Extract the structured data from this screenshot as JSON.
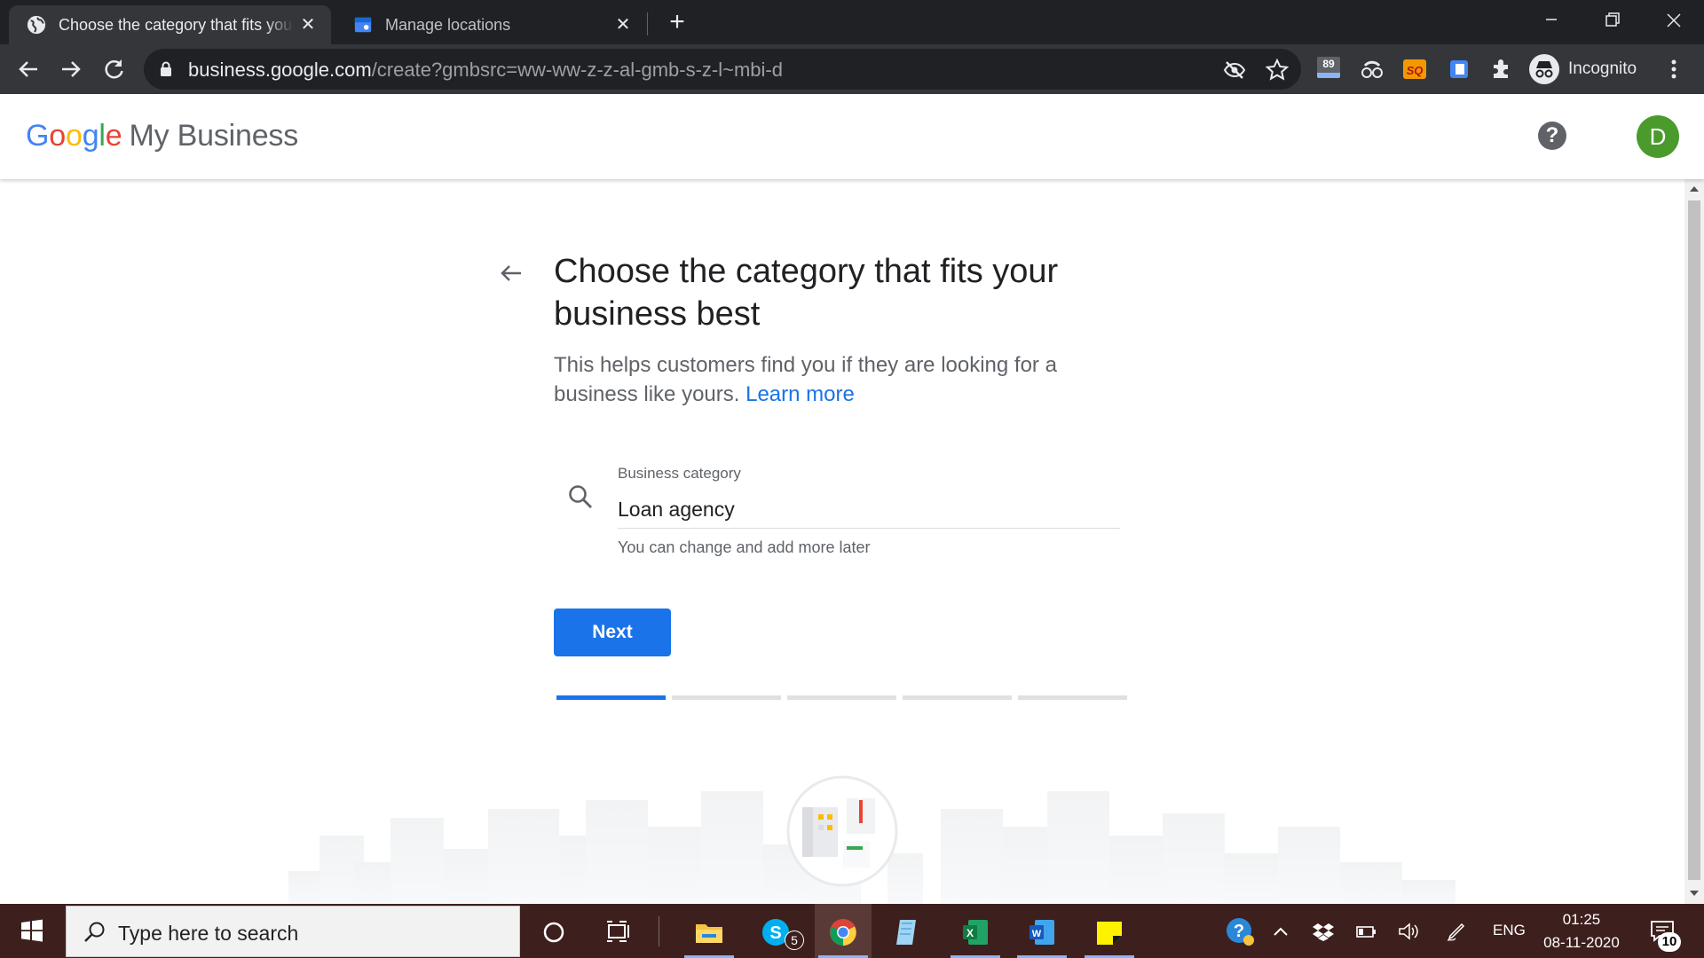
{
  "browser": {
    "tabs": [
      {
        "title": "Choose the category that fits your business best",
        "active": true
      },
      {
        "title": "Manage locations",
        "active": false
      }
    ],
    "url_host": "business.google.com",
    "url_path": "/create?gmbsrc=ww-ww-z-z-al-gmb-s-z-l~mbi-d",
    "extension_badge": "89",
    "profile_label": "Incognito"
  },
  "header": {
    "logo_letters": [
      "G",
      "o",
      "o",
      "g",
      "l",
      "e"
    ],
    "product_name": "My Business",
    "help_glyph": "?",
    "avatar_initial": "D",
    "avatar_color": "#4a9a2c"
  },
  "main": {
    "title": "Choose the category that fits your business best",
    "description": "This helps customers find you if they are looking for a business like yours.",
    "learn_more": "Learn more",
    "field_label": "Business category",
    "field_value": "Loan agency",
    "field_hint": "You can change and add more later",
    "next_label": "Next",
    "progress": {
      "current_step": 1,
      "total_steps": 5
    },
    "accent_color": "#1a73e8"
  },
  "taskbar": {
    "search_placeholder": "Type here to search",
    "skype_badge": "5",
    "language": "ENG",
    "time": "01:25",
    "date": "08-11-2020",
    "notification_count": "10"
  }
}
